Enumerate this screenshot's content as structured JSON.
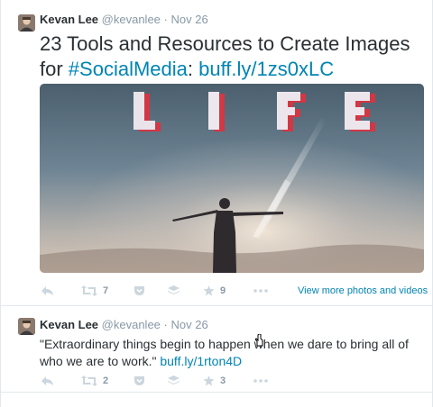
{
  "tweets": [
    {
      "name": "Kevan Lee",
      "handle": "@kevanlee",
      "separator": "·",
      "date": "Nov 26",
      "text": "23 Tools and Resources to Create Images for ",
      "hashtag": "#SocialMedia",
      "colon": ": ",
      "link": "buff.ly/1zs0xLC",
      "media_word": "LIFE",
      "actions": {
        "retweets": "7",
        "favorites": "9"
      },
      "view_more": "View more photos and videos"
    },
    {
      "name": "Kevan Lee",
      "handle": "@kevanlee",
      "separator": "·",
      "date": "Nov 26",
      "text": "\"Extraordinary things begin to happen when we dare to bring all of who we are to work.\" ",
      "link": "buff.ly/1rton4D",
      "actions": {
        "retweets": "2",
        "favorites": "3"
      }
    }
  ],
  "colors": {
    "link": "#0084b4",
    "text": "#292f33",
    "muted": "#8899a6",
    "icon": "#ccd6dd"
  }
}
